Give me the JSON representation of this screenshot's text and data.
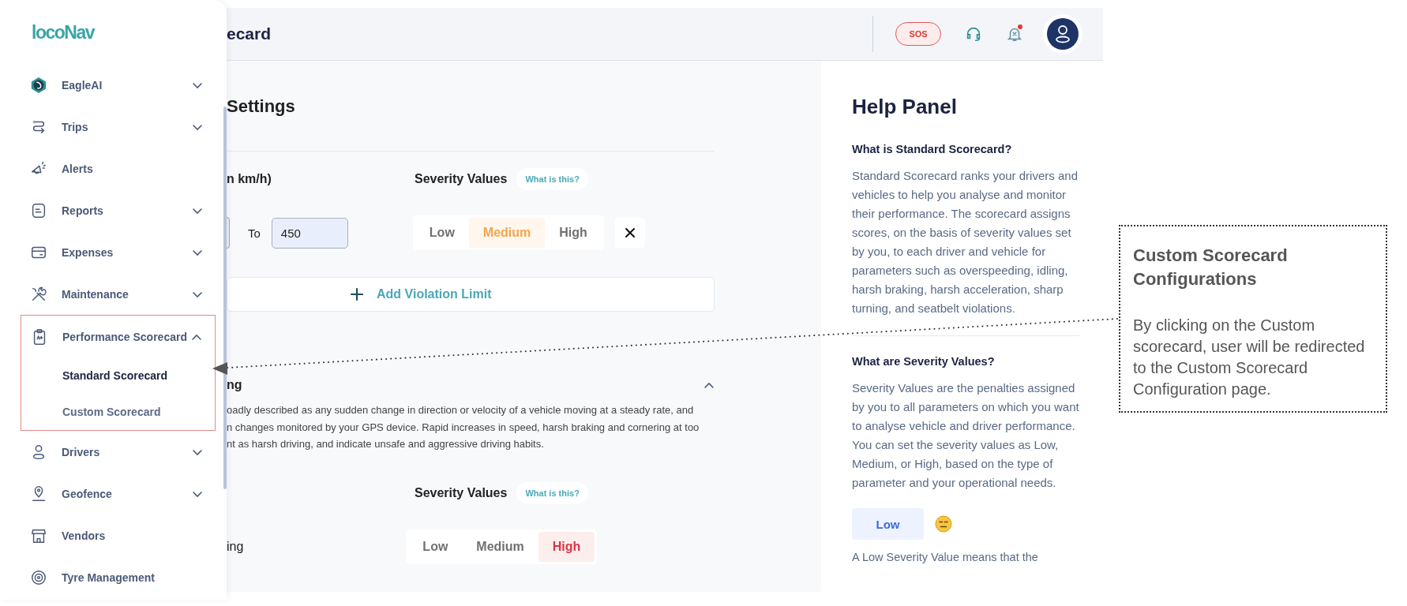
{
  "sidebar": {
    "logo": "locoNav",
    "items": [
      {
        "label": "EagleAI",
        "kind": "group",
        "expanded": false
      },
      {
        "label": "Trips",
        "kind": "group",
        "expanded": false
      },
      {
        "label": "Alerts",
        "kind": "link"
      },
      {
        "label": "Reports",
        "kind": "group",
        "expanded": false
      },
      {
        "label": "Expenses",
        "kind": "group",
        "expanded": false
      },
      {
        "label": "Maintenance",
        "kind": "group",
        "expanded": false
      },
      {
        "label": "Performance Scorecard",
        "kind": "group",
        "expanded": true,
        "highlighted": true,
        "children": [
          {
            "label": "Standard Scorecard",
            "selected": true
          },
          {
            "label": "Custom Scorecard",
            "selected": false
          }
        ]
      },
      {
        "label": "Drivers",
        "kind": "group",
        "expanded": false
      },
      {
        "label": "Geofence",
        "kind": "group",
        "expanded": false
      },
      {
        "label": "Vendors",
        "kind": "link"
      },
      {
        "label": "Tyre Management",
        "kind": "link"
      }
    ]
  },
  "header": {
    "title": "ecard",
    "sos": "SOS",
    "notification_dot": true
  },
  "main": {
    "heading": "Settings",
    "speed": {
      "label": "n km/h)",
      "severity_label": "Severity Values",
      "help_link": "What is this?",
      "to_label": "To",
      "to_value": "450",
      "options": [
        {
          "label": "Low",
          "selected": false
        },
        {
          "label": "Medium",
          "selected": true
        },
        {
          "label": "High",
          "selected": false
        }
      ],
      "add_button": "Add Violation Limit"
    },
    "harsh": {
      "title": "ng",
      "expanded": true,
      "description_lines": [
        "oadly described as any sudden change in direction or velocity of a vehicle moving at a steady rate, and",
        "n changes monitored by your GPS device. Rapid increases in speed, harsh braking and cornering at too",
        "nt as harsh driving, and indicate unsafe and aggressive driving habits."
      ],
      "severity_label": "Severity Values",
      "help_link": "What is this?",
      "rows": [
        {
          "label": "ing",
          "options": [
            {
              "label": "Low",
              "selected": false
            },
            {
              "label": "Medium",
              "selected": false
            },
            {
              "label": "High",
              "selected": true
            }
          ]
        }
      ]
    }
  },
  "help_panel": {
    "title": "Help Panel",
    "sections": [
      {
        "question": "What is Standard Scorecard?",
        "answer": "Standard Scorecard ranks your drivers and vehicles to help you analyse and monitor their performance. The scorecard assigns scores, on the basis of severity values set by you, to each driver and vehicle for parameters such as overspeeding, idling, harsh braking, harsh acceleration, sharp turning, and seatbelt violations."
      },
      {
        "question": "What are Severity Values?",
        "answer": "Severity Values are the penalties assigned by you to all parameters on which you want to analyse vehicle and driver performance. You can set the severity values as Low, Medium, or High, based on the type of parameter and your operational needs."
      }
    ],
    "chip": "Low",
    "chip_text": "A Low Severity Value means that the"
  },
  "annotation": {
    "title": "Custom Scorecard Configurations",
    "body": "By clicking on the Custom scorecard, user will be redirected to the Custom Scorecard Configuration page."
  }
}
